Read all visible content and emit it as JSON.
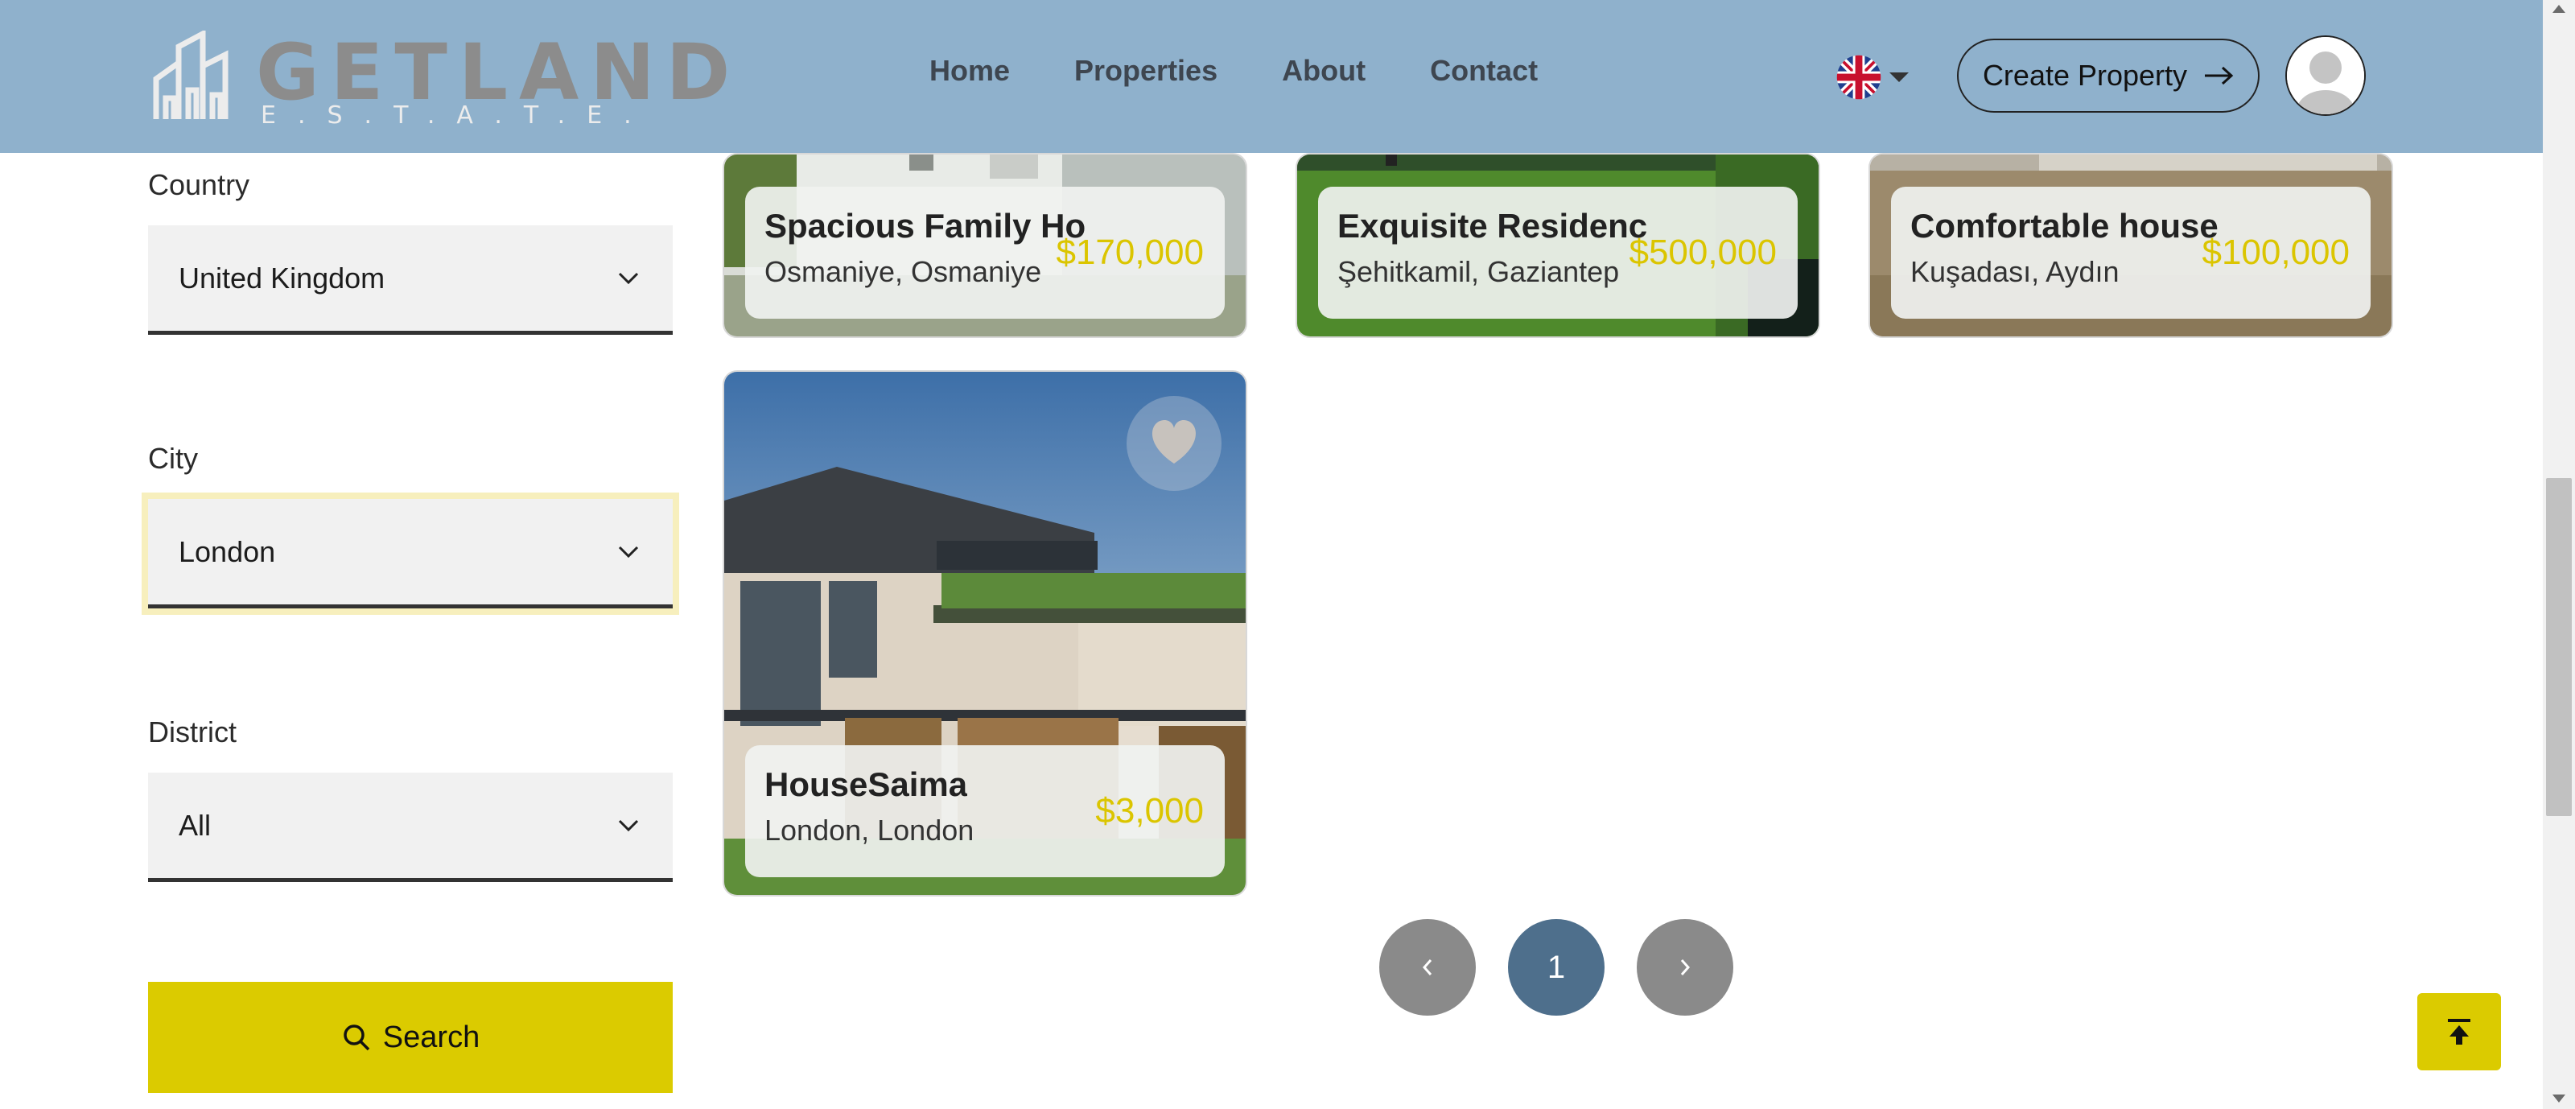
{
  "header": {
    "logo": {
      "word": "GETLAND",
      "sub": "E.S.T.A.T.E."
    },
    "nav": [
      "Home",
      "Properties",
      "About",
      "Contact"
    ],
    "language_icon": "uk-flag-icon",
    "create_label": "Create Property",
    "bg_color": "#8fb1cc"
  },
  "filters": {
    "country": {
      "label": "Country",
      "value": "United Kingdom"
    },
    "city": {
      "label": "City",
      "value": "London"
    },
    "district": {
      "label": "District",
      "value": "All"
    },
    "search_label": "Search",
    "accent_color": "#dbcb00"
  },
  "listings": [
    {
      "title": "Spacious Family Ho",
      "location": "Osmaniye, Osmaniye",
      "price": "$170,000"
    },
    {
      "title": "Exquisite Residenc",
      "location": "Şehitkamil, Gaziantep",
      "price": "$500,000"
    },
    {
      "title": "Comfortable house",
      "location": "Kuşadası, Aydın",
      "price": "$100,000"
    },
    {
      "title": "HouseSaima",
      "location": "London, London",
      "price": "$3,000"
    }
  ],
  "pagination": {
    "current": "1"
  }
}
